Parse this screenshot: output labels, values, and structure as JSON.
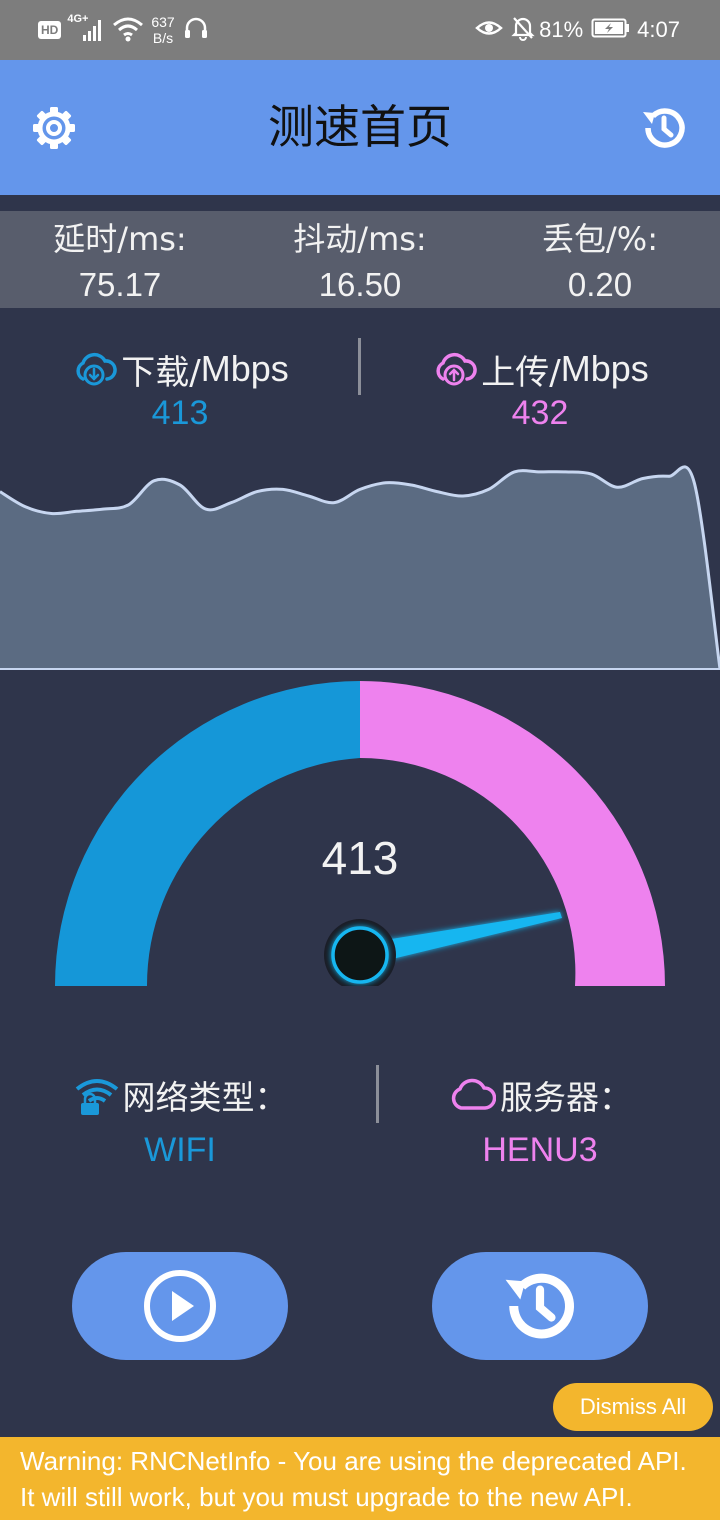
{
  "status_bar": {
    "network_badge": "HD",
    "network_type": "4G+",
    "net_speed_value": "637",
    "net_speed_unit": "B/s",
    "battery": "81%",
    "time": "4:07"
  },
  "header": {
    "title": "测速首页",
    "settings_icon": "gear-icon",
    "history_icon": "history-clock-icon"
  },
  "stats": [
    {
      "label": "延时/ms:",
      "value": "75.17"
    },
    {
      "label": "抖动/ms:",
      "value": "16.50"
    },
    {
      "label": "丢包/%:",
      "value": "0.20"
    }
  ],
  "speeds": {
    "download": {
      "label": "下载/",
      "unit": "Mbps",
      "value": "413",
      "color": "#1a98d9",
      "icon": "cloud-download-icon"
    },
    "upload": {
      "label": "上传/",
      "unit": "Mbps",
      "value": "432",
      "color": "#ee82ee",
      "icon": "cloud-upload-icon"
    }
  },
  "chart_data": {
    "type": "area",
    "y": [
      0.81,
      0.74,
      0.71,
      0.72,
      0.73,
      0.75,
      0.86,
      0.84,
      0.73,
      0.76,
      0.81,
      0.82,
      0.79,
      0.76,
      0.82,
      0.85,
      0.84,
      0.81,
      0.79,
      0.82,
      0.9,
      0.9,
      0.9,
      0.89,
      0.83,
      0.87,
      0.88,
      0.85,
      0.0
    ],
    "ylim": [
      0,
      1
    ],
    "fill_color": "#5b6b82",
    "line_color": "#c7d6f0"
  },
  "gauge": {
    "value": "413",
    "download_color": "#1597d8",
    "upload_color": "#ee82ee",
    "needle_color": "#16b6f0"
  },
  "info": {
    "network": {
      "label": "网络类型：",
      "value": "WIFI",
      "color": "#1a98d9",
      "icon": "wifi-lock-icon"
    },
    "server": {
      "label": "服务器：",
      "value": "HENU3",
      "color": "#ee82ee",
      "icon": "cloud-icon"
    }
  },
  "buttons": {
    "start_icon": "play-icon",
    "history_icon": "history-clock-icon"
  },
  "warning": {
    "dismiss_label": "Dismiss All",
    "text": "Warning: RNCNetInfo - You are using the deprecated API. It will still work, but you must upgrade to the new API."
  }
}
